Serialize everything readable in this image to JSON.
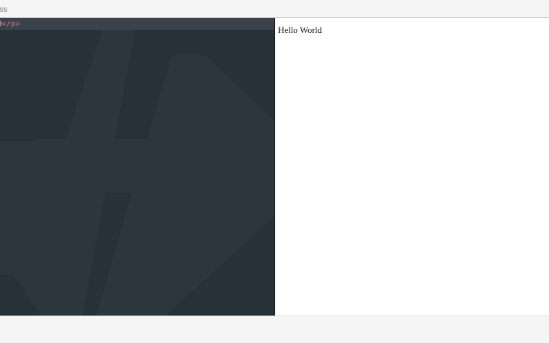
{
  "topbar": {
    "tab_label": "css"
  },
  "editor": {
    "code_fragment_text": "d",
    "code_fragment_tag": "</p>",
    "background_color": "#263238",
    "watermark_color": "#2b363d"
  },
  "preview": {
    "text": "Hello World"
  }
}
